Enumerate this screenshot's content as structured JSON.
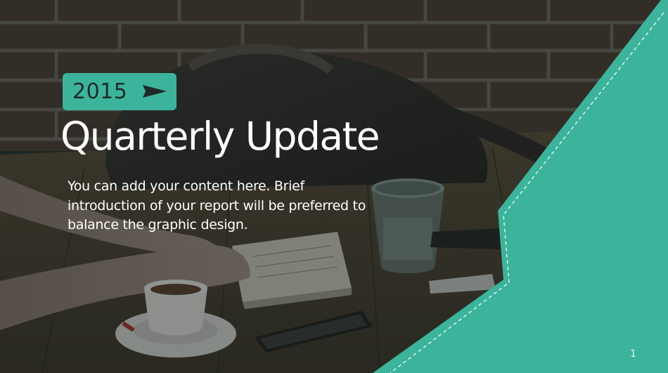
{
  "slide": {
    "year": "2015",
    "title": "Quarterly Update",
    "intro": "You can add your content here. Brief introduction of your report will be preferred to balance the graphic design.",
    "page_number": "1"
  },
  "colors": {
    "accent": "#3bb49b",
    "dark_overlay": "#1f2b27",
    "text_light": "#ffffff"
  },
  "icons": {
    "badge_arrow": "play-arrow-icon"
  }
}
